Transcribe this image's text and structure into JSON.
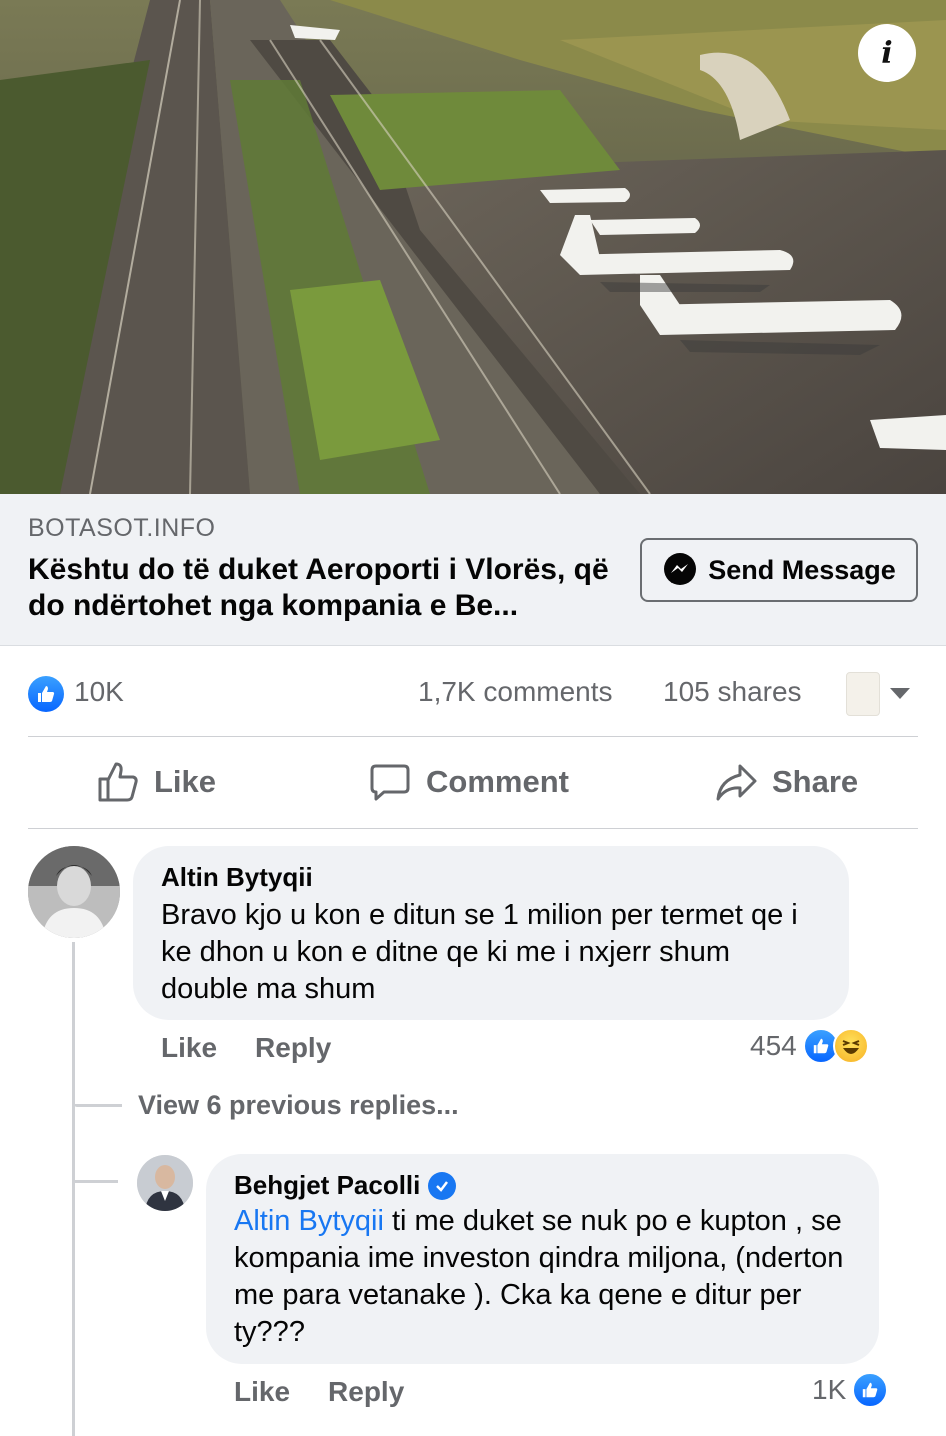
{
  "post": {
    "link_preview": {
      "domain": "BOTASOT.INFO",
      "title": "Kështu do të duket Aeroporti i Vlorës, që do ndërtohet nga kompania e Be...",
      "send_button_label": "Send Message"
    },
    "info_button_label": "i",
    "stats": {
      "reactions": "10K",
      "comments": "1,7K comments",
      "shares": "105 shares"
    },
    "actions": {
      "like": "Like",
      "comment": "Comment",
      "share": "Share"
    }
  },
  "comments": [
    {
      "author": "Altin Bytyqii",
      "text": "Bravo kjo u kon e ditun se 1 milion per termet qe i ke dhon u kon e ditne qe ki me i nxjerr shum double ma shum",
      "like_label": "Like",
      "reply_label": "Reply",
      "reaction_count": "454"
    }
  ],
  "view_previous_replies": "View 6 previous replies...",
  "replies": [
    {
      "author": "Behgjet Pacolli",
      "verified": true,
      "mention": "Altin Bytyqii",
      "text": " ti me duket se nuk po e kupton ,  se kompania ime investon qindra miljona, (nderton me para vetanake ). Cka ka qene e ditur per ty???",
      "like_label": "Like",
      "reply_label": "Reply",
      "reaction_count": "1K"
    }
  ],
  "colors": {
    "facebook_blue": "#1877f2",
    "secondary_text": "#65676b",
    "bubble_bg": "#f0f2f5"
  }
}
